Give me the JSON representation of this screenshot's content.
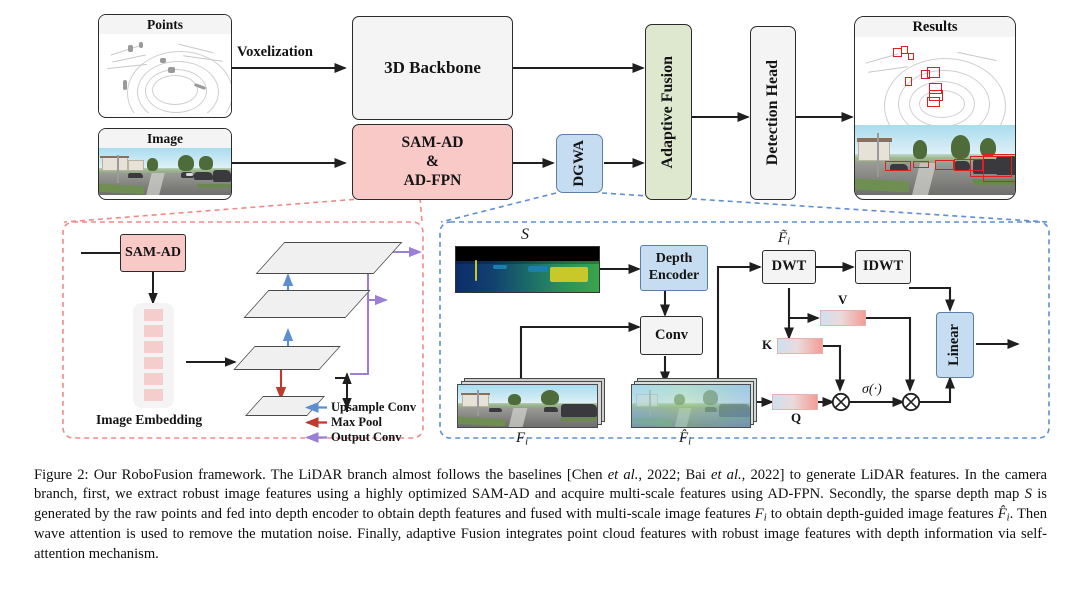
{
  "figure": {
    "top_row": {
      "points_card": {
        "title": "Points"
      },
      "image_card": {
        "title": "Image"
      },
      "voxelization_label": "Voxelization",
      "backbone_box": "3D Backbone",
      "camera_box_line1": "SAM-AD",
      "camera_box_line2": "&",
      "camera_box_line3": "AD-FPN",
      "dgwa_box": "DGWA",
      "fusion_box": "Adaptive Fusion",
      "head_box": "Detection Head",
      "results_card": {
        "title": "Results"
      }
    },
    "left_panel": {
      "sam_ad_box": "SAM-AD",
      "image_embedding_label": "Image Embedding",
      "legend": [
        {
          "label": "Upsample Conv",
          "color": "#5b8fd0"
        },
        {
          "label": "Max Pool",
          "color": "#c0392b"
        },
        {
          "label": "Output Conv",
          "color": "#9b7fd4"
        }
      ]
    },
    "right_panel": {
      "sparse_depth_label": "S",
      "depth_encoder_box_line1": "Depth",
      "depth_encoder_box_line2": "Encoder",
      "conv_box": "Conv",
      "dwt_box": "DWT",
      "idwt_box": "IDWT",
      "linear_box": "Linear",
      "feature_label": "F",
      "feature_label_sub": "i",
      "hat_feature_label": "F",
      "tilde_feature_label": "F",
      "sigma_label": "σ(·)",
      "attn_labels": {
        "k": "K",
        "v": "V",
        "q": "Q"
      }
    }
  },
  "caption": {
    "number": "Figure 2:",
    "text_1": " Our RoboFusion framework. The LiDAR branch almost follows the baselines  [Chen ",
    "italic_1": "et al.",
    "text_2": ", 2022; Bai ",
    "italic_2": "et al.",
    "text_3": ", 2022] to generate LiDAR features. In the camera branch, first, we extract robust image features using a highly optimized SAM-AD and acquire multi-scale features using AD-FPN. Secondly, the sparse depth map ",
    "math_S": "S",
    "text_4": " is generated by the raw points and fed into depth encoder to obtain depth features and fused with multi-scale image features ",
    "math_F": "F",
    "math_F_sub": "i",
    "text_5": " to obtain depth-guided image features ",
    "math_Fhat": "F̂",
    "math_Fhat_sub": "i",
    "text_6": ". Then wave attention is used to remove the mutation noise. Finally, adaptive Fusion integrates point cloud features with robust image features with depth information via self-attention mechanism."
  },
  "colors": {
    "pink_box": "#f9c9c8",
    "blue_box": "#c6dcf0",
    "green_box": "#dde8cf",
    "gray_box": "#f4f4f4",
    "pink_dashed_panel": "#f08a88",
    "blue_dashed_panel": "#5f8ed1",
    "upsample_arrow": "#5b8fd0",
    "maxpool_arrow": "#c0392b",
    "output_arrow": "#9b7fd4",
    "detection_red": "#e02020"
  }
}
